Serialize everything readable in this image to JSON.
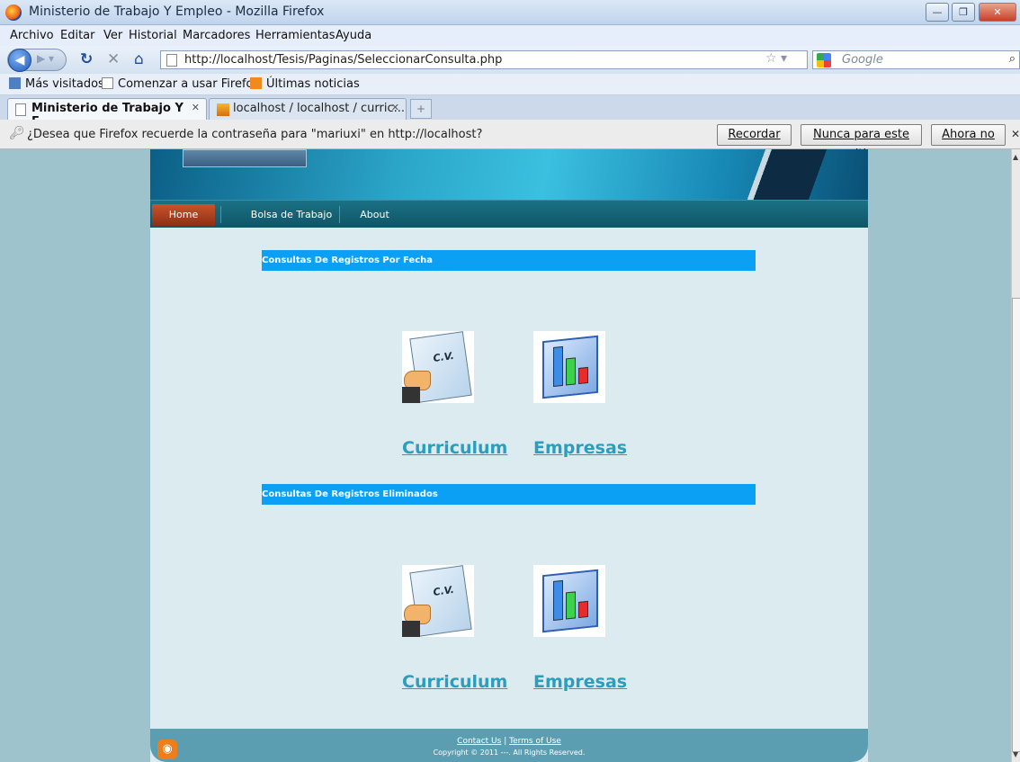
{
  "window": {
    "title": "Ministerio de Trabajo Y Empleo - Mozilla Firefox"
  },
  "menu": [
    "Archivo",
    "Editar",
    "Ver",
    "Historial",
    "Marcadores",
    "Herramientas",
    "Ayuda"
  ],
  "address": {
    "url": "http://localhost/Tesis/Paginas/SeleccionarConsulta.php"
  },
  "search": {
    "placeholder": "Google"
  },
  "bookmarks": [
    "Más visitados",
    "Comenzar a usar Firefox",
    "Últimas noticias"
  ],
  "tabs": [
    {
      "label": "Ministerio de Trabajo Y E...",
      "active": true
    },
    {
      "label": "localhost / localhost / curric...",
      "active": false
    }
  ],
  "password_prompt": {
    "message": "¿Desea que Firefox recuerde la contraseña para \"mariuxi\" en http://localhost?",
    "remember": "Recordar",
    "never": "Nunca para este sitio",
    "not_now": "Ahora no"
  },
  "site_nav": [
    "Home",
    "Bolsa de Trabajo",
    "About"
  ],
  "sections": [
    {
      "title": "Consultas De Registros Por Fecha",
      "links": [
        "Curriculum",
        "Empresas"
      ]
    },
    {
      "title": "Consultas De Registros Eliminados",
      "links": [
        "Curriculum",
        "Empresas"
      ]
    }
  ],
  "footer": {
    "contact": "Contact Us",
    "terms": "Terms of Use",
    "separator": "|",
    "copyright": "Copyright © 2011 ---. All Rights Reserved."
  },
  "colors": {
    "section_bar": "#0ca0f4",
    "link": "#2a9ec0",
    "home_button": "#b5441f"
  },
  "icons": {
    "cv": "cv-document-hand-icon",
    "companies": "bar-chart-cube-icon",
    "rss": "rss-feed-icon"
  }
}
